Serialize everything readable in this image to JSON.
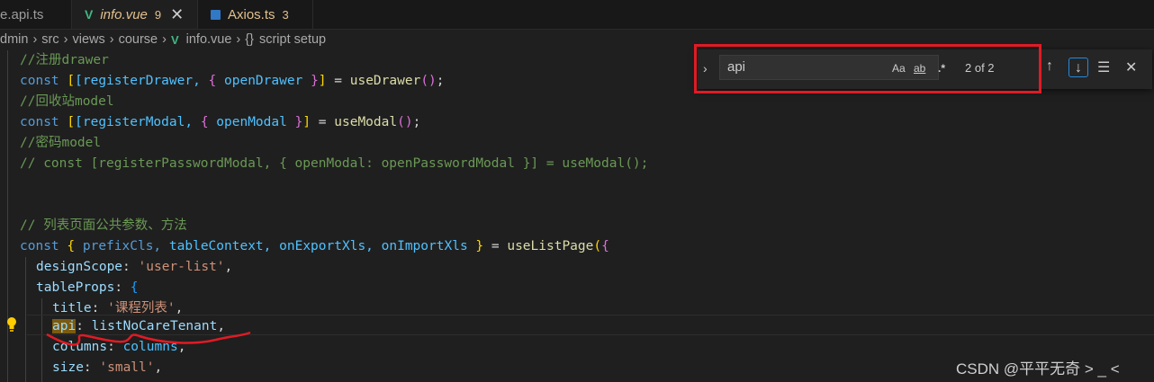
{
  "tabs": [
    {
      "label": "e.api.ts",
      "icon": "ts-icon"
    },
    {
      "label": "info.vue",
      "problems": "9",
      "icon": "vue-icon",
      "active": true
    },
    {
      "label": "Axios.ts",
      "problems": "3",
      "icon": "ts-icon"
    }
  ],
  "breadcrumb": [
    "dmin",
    "src",
    "views",
    "course",
    "info.vue",
    "script setup"
  ],
  "find": {
    "query": "api",
    "match_case": "Aa",
    "whole_word": "ab",
    "regex": ".*",
    "result": "2 of 2"
  },
  "code": {
    "l1": "//注册drawer",
    "l2": [
      "const",
      "[registerDrawer,",
      "{",
      "openDrawer",
      "}]",
      "=",
      "useDrawer",
      "();"
    ],
    "l3": "//回收站model",
    "l4": [
      "const",
      "[registerModal,",
      "{",
      "openModal",
      "}]",
      "=",
      "useModal",
      "();"
    ],
    "l5": "//密码model",
    "l6": "// const [registerPasswordModal, { openModal: openPasswordModal }] = useModal();",
    "l9": "// 列表页面公共参数、方法",
    "l10": [
      "const",
      "{",
      "prefixCls,",
      "tableContext,",
      "onExportXls,",
      "onImportXls",
      "}",
      "=",
      "useListPage",
      "({"
    ],
    "l11": [
      "designScope",
      ":",
      "'user-list'",
      ","
    ],
    "l12": [
      "tableProps",
      ":",
      "{"
    ],
    "l13": [
      "title",
      ":",
      "'课程列表'",
      ","
    ],
    "l14": [
      "api",
      ":",
      "listNoCareTenant",
      ","
    ],
    "l15": [
      "columns",
      ":",
      "columns",
      ","
    ],
    "l16": [
      "size",
      ":",
      "'small'",
      ","
    ]
  },
  "watermark": "CSDN @平平无奇 > _ <",
  "colors": {
    "annotation": "#e01b24",
    "vue": "#41b883",
    "ts": "#3178c6"
  }
}
